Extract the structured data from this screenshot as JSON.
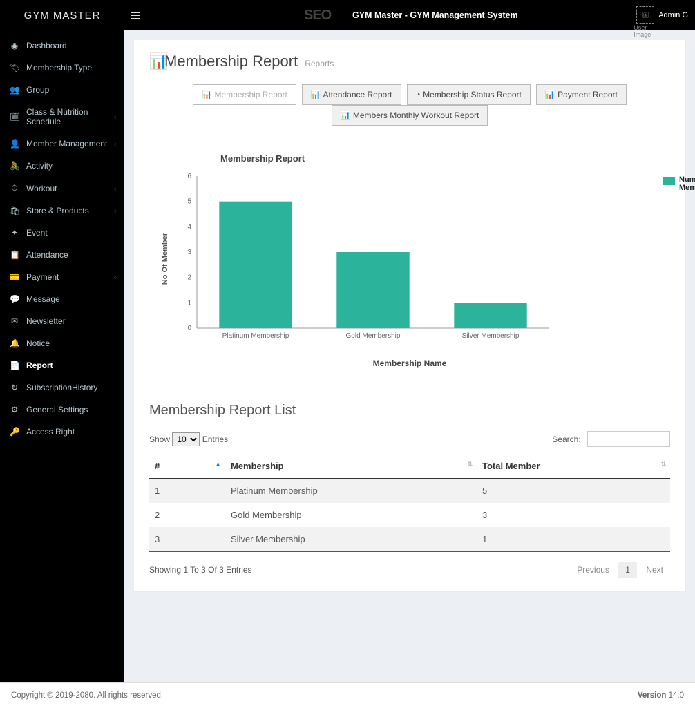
{
  "brand": "GYM MASTER",
  "seo_text": "SEO",
  "app_title": "GYM Master - GYM Management System",
  "user": {
    "name": "Admin G",
    "img_alt": "User Image"
  },
  "sidebar": [
    {
      "icon": "◉",
      "label": "Dashboard",
      "caret": false
    },
    {
      "icon": "🏷",
      "label": "Membership Type",
      "caret": false
    },
    {
      "icon": "👥",
      "label": "Group",
      "caret": false
    },
    {
      "icon": "🗓",
      "label": "Class & Nutrition Schedule",
      "caret": true
    },
    {
      "icon": "👤",
      "label": "Member Management",
      "caret": true
    },
    {
      "icon": "🚴",
      "label": "Activity",
      "caret": false
    },
    {
      "icon": "⏱",
      "label": "Workout",
      "caret": true
    },
    {
      "icon": "🛍",
      "label": "Store & Products",
      "caret": true
    },
    {
      "icon": "✦",
      "label": "Event",
      "caret": false
    },
    {
      "icon": "📋",
      "label": "Attendance",
      "caret": false
    },
    {
      "icon": "💳",
      "label": "Payment",
      "caret": true
    },
    {
      "icon": "💬",
      "label": "Message",
      "caret": false
    },
    {
      "icon": "✉",
      "label": "Newsletter",
      "caret": false
    },
    {
      "icon": "🔔",
      "label": "Notice",
      "caret": false
    },
    {
      "icon": "📄",
      "label": "Report",
      "caret": false,
      "active": true
    },
    {
      "icon": "↻",
      "label": "SubscriptionHistory",
      "caret": false
    },
    {
      "icon": "⚙",
      "label": "General Settings",
      "caret": false
    },
    {
      "icon": "🔑",
      "label": "Access Right",
      "caret": false
    }
  ],
  "page": {
    "title": "Membership Report",
    "subtitle": "Reports"
  },
  "tabs": [
    {
      "icon": "📊",
      "label": "Membership Report",
      "active": true
    },
    {
      "icon": "📊",
      "label": "Attendance Report"
    },
    {
      "icon": "◔",
      "label": "Membership Status Report"
    },
    {
      "icon": "📊",
      "label": "Payment Report"
    },
    {
      "icon": "📊",
      "label": "Members Monthly Workout Report"
    }
  ],
  "chart_data": {
    "type": "bar",
    "title": "Membership Report",
    "xlabel": "Membership Name",
    "ylabel": "No Of Member",
    "legend": "Number Of Member",
    "categories": [
      "Platinum Membership",
      "Gold Membership",
      "Silver Membership"
    ],
    "values": [
      5,
      3,
      1
    ],
    "ylim": [
      0,
      6
    ],
    "yticks": [
      0,
      1,
      2,
      3,
      4,
      5,
      6
    ],
    "bar_color": "#2bb39b"
  },
  "list": {
    "title": "Membership Report List",
    "show": "Show",
    "entries": "Entries",
    "page_size": "10",
    "search": "Search:",
    "columns": [
      "#",
      "Membership",
      "Total Member"
    ],
    "rows": [
      {
        "n": "1",
        "m": "Platinum Membership",
        "t": "5"
      },
      {
        "n": "2",
        "m": "Gold Membership",
        "t": "3"
      },
      {
        "n": "3",
        "m": "Silver Membership",
        "t": "1"
      }
    ],
    "info": "Showing 1 To 3 Of 3 Entries",
    "prev": "Previous",
    "next": "Next",
    "page": "1"
  },
  "footer": {
    "left": "Copyright © 2019-2080. All rights reserved.",
    "right_label": "Version ",
    "right_val": "14.0"
  }
}
